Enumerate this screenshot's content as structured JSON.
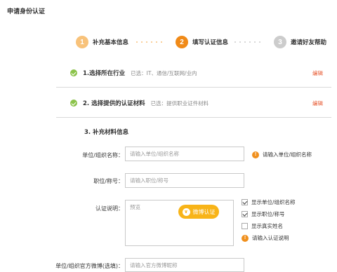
{
  "page": {
    "title": "申请身份认证"
  },
  "stepper": {
    "steps": [
      {
        "number": "1",
        "label": "补充基本信息",
        "color": "#f8c27a",
        "label_color": "#333333"
      },
      {
        "number": "2",
        "label": "填写认证信息",
        "color": "#f08a18",
        "label_color": "#333333"
      },
      {
        "number": "3",
        "label": "邀请好友帮助",
        "color": "#cccccc",
        "label_color": "#333333"
      }
    ],
    "dots_active_color": "#f8c27a",
    "dots_inactive_color": "#cccccc"
  },
  "sections": [
    {
      "title": "1.选择所在行业",
      "value": "已选：IT、通信/互联网/业内",
      "edit_label": "编辑"
    },
    {
      "title": "2. 选择提供的认证材料",
      "value": "已选：提供职业证件材料",
      "edit_label": "编辑"
    }
  ],
  "material": {
    "title": "3. 补充材料信息",
    "org_name": {
      "label": "单位/组织名称：",
      "placeholder": "请输入单位/组织名称",
      "warning": "请输入单位/组织名称"
    },
    "position": {
      "label": "职位/称号：",
      "placeholder": "请输入职位/称号"
    },
    "description": {
      "label": "认证说明：",
      "placeholder": "预览",
      "weibo_button": "微博认证"
    },
    "options": [
      {
        "label": "显示单位/组织名称",
        "checked": true
      },
      {
        "label": "显示职位/称号",
        "checked": true
      },
      {
        "label": "显示真实姓名",
        "checked": false
      }
    ],
    "description_warning": "请输入认证说明",
    "weibo": {
      "label": "单位/组织官方微博(选填)：",
      "placeholder": "请输入官方微博昵称"
    }
  },
  "colors": {
    "accent": "#f08a18",
    "edit": "#e7552c",
    "check": "#8bc34a",
    "warn": "#f0901e"
  }
}
